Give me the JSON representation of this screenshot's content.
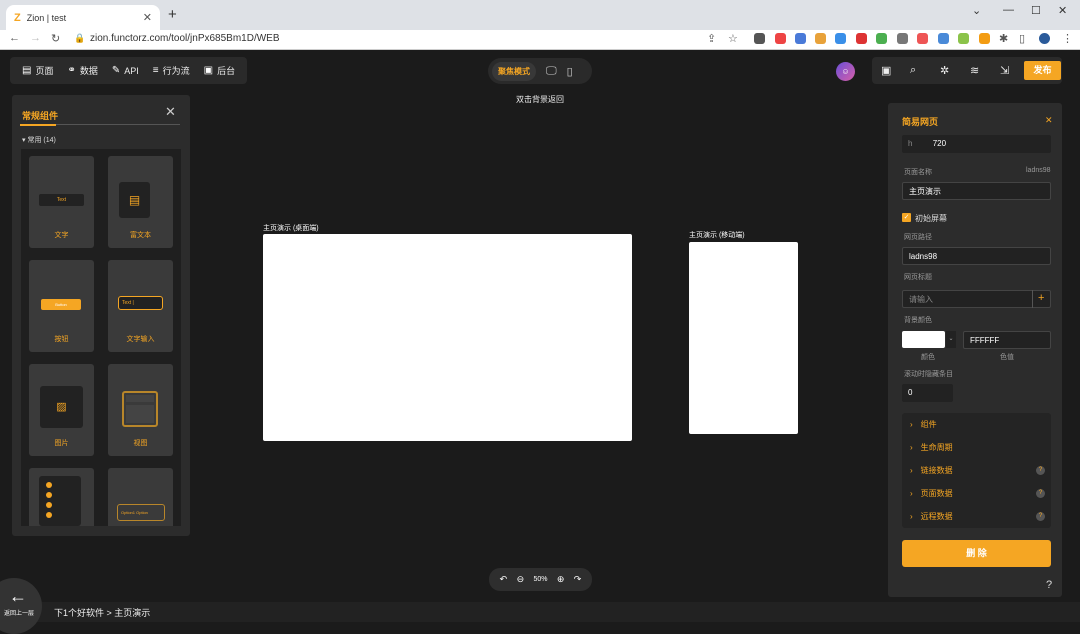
{
  "browser": {
    "tab_title": "Zion | test",
    "url": "zion.functorz.com/tool/jnPx685Bm1D/WEB"
  },
  "topnav": {
    "items": [
      {
        "label": "页面",
        "icon": "page-icon"
      },
      {
        "label": "数据",
        "icon": "data-icon"
      },
      {
        "label": "API",
        "icon": "api-icon"
      },
      {
        "label": "行为流",
        "icon": "flow-icon"
      },
      {
        "label": "后台",
        "icon": "backend-icon"
      }
    ]
  },
  "focus": {
    "label": "聚焦模式"
  },
  "toolbar": {
    "publish_label": "发布"
  },
  "canvas": {
    "hint": "双击背景返回",
    "desktop_label": "主页演示 (桌面端)",
    "mobile_label": "主页演示 (移动端)"
  },
  "left_panel": {
    "title": "常规组件",
    "group_label": "常用 (14)",
    "components": [
      {
        "label": "文字",
        "preview": "Text"
      },
      {
        "label": "富文本",
        "preview": ""
      },
      {
        "label": "按钮",
        "preview": "Button"
      },
      {
        "label": "文字输入",
        "preview": "Text |"
      },
      {
        "label": "图片",
        "preview": ""
      },
      {
        "label": "视图",
        "preview": ""
      },
      {
        "label": "",
        "preview": ""
      },
      {
        "label": "",
        "preview": "Option1  Option"
      }
    ]
  },
  "zoom": {
    "value": "50%"
  },
  "bottom": {
    "back_label": "返回上一层",
    "breadcrumb": "下1个好软件 > 主页演示"
  },
  "right_panel": {
    "title": "简易网页",
    "height_label": "h",
    "height_value": "720",
    "page_name_label": "页面名称",
    "page_id": "ladns98",
    "page_name_value": "主页演示",
    "initial_screen_label": "初始屏幕",
    "page_path_label": "网页路径",
    "page_path_value": "ladns98",
    "page_title_label": "网页标题",
    "page_title_placeholder": "请输入",
    "bg_color_label": "背景颜色",
    "color_label": "颜色",
    "color_value_label": "色值",
    "color_value": "FFFFFF",
    "scroll_label": "滚动时隐藏条目",
    "scroll_value": "0",
    "sections": [
      {
        "label": "组件",
        "help": false
      },
      {
        "label": "生命周期",
        "help": false
      },
      {
        "label": "链接数据",
        "help": true
      },
      {
        "label": "页面数据",
        "help": true
      },
      {
        "label": "远程数据",
        "help": true
      }
    ],
    "delete_label": "删 除"
  }
}
